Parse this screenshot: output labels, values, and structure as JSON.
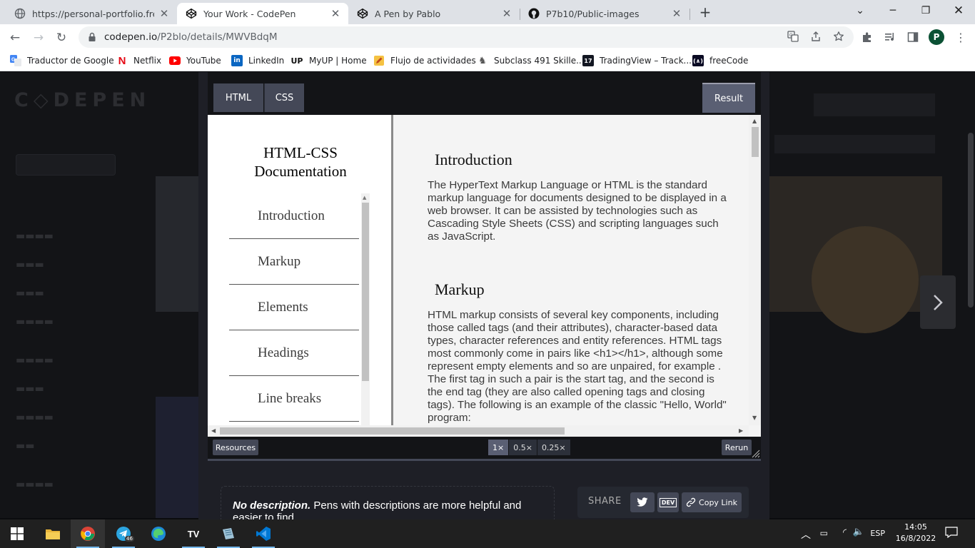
{
  "browser": {
    "tabs": [
      {
        "title": "https://personal-portfolio.freecodecamp",
        "icon": "globe-icon",
        "active": false
      },
      {
        "title": "Your Work - CodePen",
        "icon": "codepen-icon",
        "active": true
      },
      {
        "title": "A Pen by Pablo",
        "icon": "codepen-icon",
        "active": false
      },
      {
        "title": "P7b10/Public-images",
        "icon": "github-icon",
        "active": false
      }
    ],
    "url_domain": "codepen.io",
    "url_path": "/P2blo/details/MWVBdqM",
    "profile_initial": "P",
    "bookmarks": [
      {
        "label": "Traductor de Google",
        "icon": "google-translate-icon",
        "color": "#4285f4"
      },
      {
        "label": "Netflix",
        "icon": "netflix-icon",
        "color": "#e50914"
      },
      {
        "label": "YouTube",
        "icon": "youtube-icon",
        "color": "#ff0000"
      },
      {
        "label": "LinkedIn",
        "icon": "linkedin-icon",
        "color": "#0a66c2"
      },
      {
        "label": "MyUP | Home",
        "icon": "up-icon",
        "color": "#111111"
      },
      {
        "label": "Flujo de actividades",
        "icon": "pencil-icon",
        "color": "#e8a317"
      },
      {
        "label": "Subclass 491 Skille...",
        "icon": "kangaroo-icon",
        "color": "#555555"
      },
      {
        "label": "TradingView – Track...",
        "icon": "tradingview-icon",
        "color": "#131722"
      },
      {
        "label": "freeCode",
        "icon": "freecodecamp-icon",
        "color": "#0a0a23"
      }
    ]
  },
  "editor": {
    "tabs": [
      "HTML",
      "CSS"
    ],
    "result_label": "Result"
  },
  "result": {
    "nav_title": "HTML-CSS Documentation",
    "nav_links": [
      "Introduction",
      "Markup",
      "Elements",
      "Headings",
      "Line breaks"
    ],
    "sections": [
      {
        "title": "Introduction",
        "body": "The HyperText Markup Language or HTML is the standard markup language for documents designed to be displayed in a web browser. It can be assisted by technologies such as Cascading Style Sheets (CSS) and scripting languages such as JavaScript."
      },
      {
        "title": "Markup",
        "body": "HTML markup consists of several key components, including those called tags (and their attributes), character-based data types, character references and entity references. HTML tags most commonly come in pairs like <h1></h1>, although some represent empty elements and so are unpaired, for example . The first tag in such a pair is the start tag, and the second is the end tag (they are also called opening tags and closing tags). The following is an example of the classic \"Hello, World\" program:"
      }
    ]
  },
  "bottom_bar": {
    "resources_label": "Resources",
    "zoom_options": [
      "1×",
      "0.5×",
      "0.25×"
    ],
    "zoom_selected": "1×",
    "rerun_label": "Rerun"
  },
  "details": {
    "desc_bold": "No description.",
    "desc_rest": "Pens with descriptions are more helpful and easier to find.",
    "share_label": "SHARE",
    "copy_link_label": "Copy Link",
    "dev_label": "DEV"
  },
  "taskbar": {
    "apps": [
      "file-explorer-icon",
      "chrome-icon",
      "telegram-icon",
      "edge-icon",
      "tradingview-icon",
      "notepad-icon",
      "vscode-icon"
    ],
    "telegram_badge": "46",
    "language": "ESP",
    "time": "14:05",
    "date": "16/8/2022"
  },
  "colors": {
    "codepen_bg": "#131417",
    "editor_tab": "#444857",
    "profile": "#0b5134",
    "taskbar": "#202020"
  }
}
